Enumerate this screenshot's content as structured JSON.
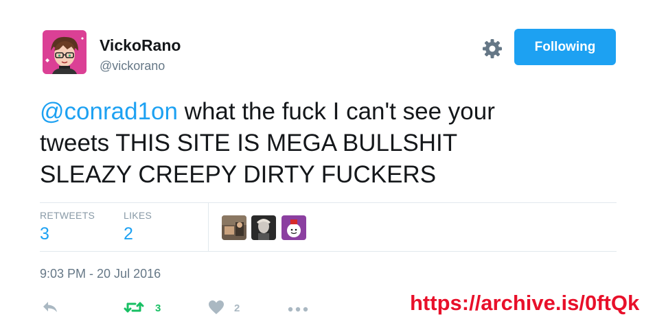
{
  "author": {
    "display_name": "VickoRano",
    "handle": "@vickorano",
    "avatar_icon": "cartoon-avatar-icon"
  },
  "follow_button": {
    "label": "Following",
    "color": "#1da1f2"
  },
  "settings_icon": "gear-icon",
  "tweet": {
    "mention": "@conrad1on",
    "line1_rest": " what the fuck I can't see your",
    "line2": "tweets THIS SITE IS MEGA BULLSHIT",
    "line3": "SLEAZY CREEPY DIRTY FUCKERS"
  },
  "stats": {
    "retweets_label": "RETWEETS",
    "retweets_value": "3",
    "likes_label": "LIKES",
    "likes_value": "2"
  },
  "likers": [
    "liker-avatar-1",
    "liker-avatar-2",
    "liker-avatar-3"
  ],
  "timestamp": "9:03 PM - 20 Jul 2016",
  "actions": {
    "reply_icon": "reply-icon",
    "retweet_icon": "retweet-icon",
    "retweet_count": "3",
    "like_icon": "heart-icon",
    "like_count": "2",
    "more_icon": "more-icon"
  },
  "watermark": "https://archive.is/0ftQk",
  "colors": {
    "accent": "#1da1f2",
    "retweet_green": "#17bf63",
    "muted": "#657786",
    "watermark_red": "#e8102a"
  }
}
